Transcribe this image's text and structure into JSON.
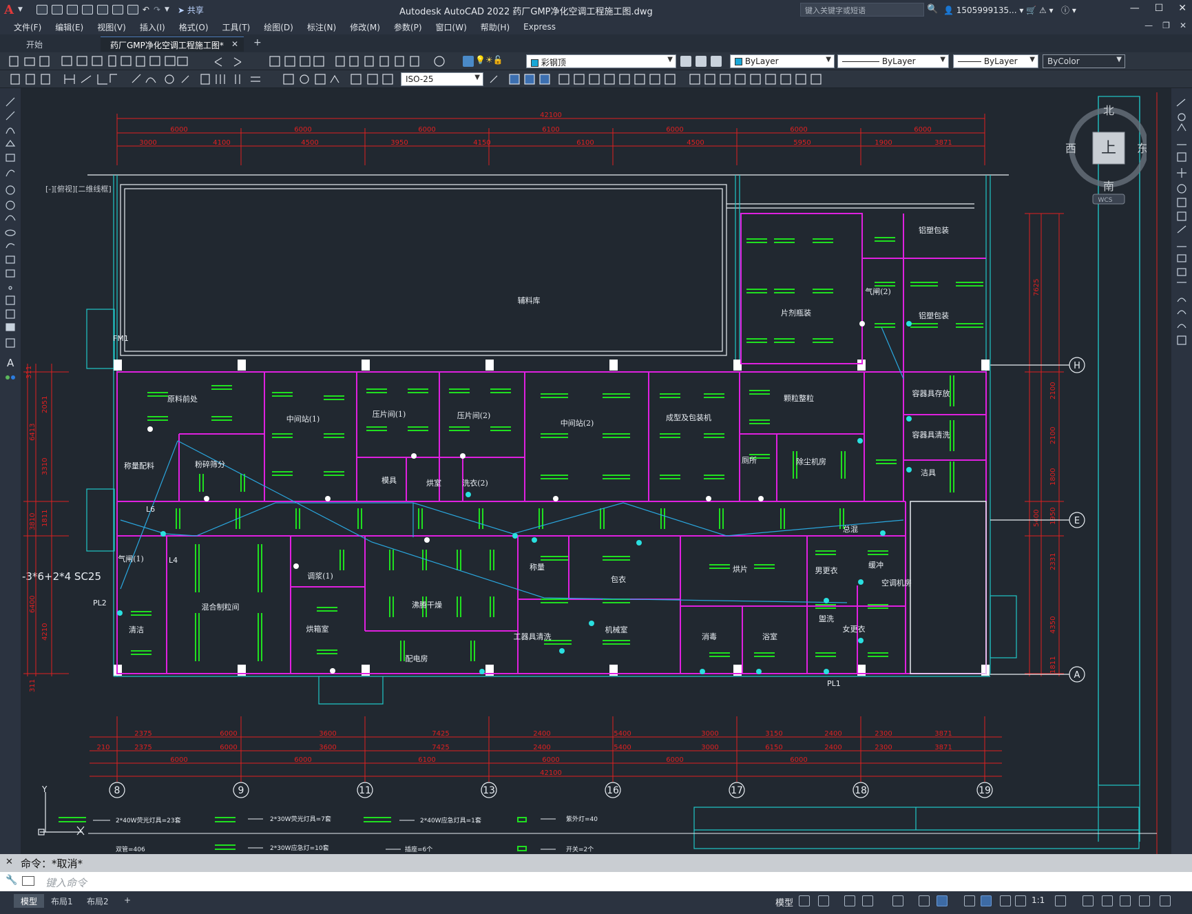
{
  "titlebar": {
    "logo": "A",
    "share": "共享",
    "app_title": "Autodesk AutoCAD 2022    药厂GMP净化空调工程施工图.dwg",
    "search_placeholder": "键入关键字或短语",
    "user": "1505999135...",
    "minimize": "—",
    "restore": "☐",
    "close": "✕"
  },
  "menu": [
    "文件(F)",
    "编辑(E)",
    "视图(V)",
    "插入(I)",
    "格式(O)",
    "工具(T)",
    "绘图(D)",
    "标注(N)",
    "修改(M)",
    "参数(P)",
    "窗口(W)",
    "帮助(H)",
    "Express"
  ],
  "tabs": {
    "start": "开始",
    "active": "药厂GMP净化空调工程施工图*",
    "add": "+"
  },
  "toolbar": {
    "layer": "彩钢顶",
    "color": "ByLayer",
    "linetype": "ByLayer",
    "lineweight": "ByLayer",
    "plotstyle": "ByColor",
    "dimstyle": "ISO-25"
  },
  "viewport_label": "[-][俯视][二维线框]",
  "navcube": {
    "north": "北",
    "south": "南",
    "east": "东",
    "west": "西",
    "top": "上",
    "ucs": "WCS"
  },
  "drawing": {
    "top_total": "42100",
    "top_row1": [
      "6000",
      "6000",
      "6000",
      "6100",
      "6000",
      "6000",
      "6000"
    ],
    "top_row2": [
      "3000",
      "4100",
      "4500",
      "3950",
      "4150",
      "6100",
      "4500",
      "5950",
      "1900",
      "3871"
    ],
    "bottom_row1": [
      "2375",
      "6000",
      "3600",
      "7425",
      "2400",
      "5400",
      "3000",
      "3150",
      "2400",
      "2300",
      "3871"
    ],
    "bottom_row2": [
      "210",
      "2375",
      "6000",
      "3600",
      "7425",
      "2400",
      "5400",
      "3000",
      "6150",
      "2400",
      "2300",
      "3871"
    ],
    "bottom_row3": [
      "6000",
      "6000",
      "6100",
      "6000",
      "6000",
      "6000"
    ],
    "bottom_total": "42100",
    "grid_bottom": [
      "8",
      "9",
      "11",
      "13",
      "16",
      "17",
      "18",
      "19"
    ],
    "grid_right": [
      "H",
      "E",
      "A"
    ],
    "right_dims": [
      "7625",
      "2100",
      "2100",
      "1800",
      "1950",
      "5400",
      "2331",
      "4350",
      "1811"
    ],
    "left_dims": [
      "311",
      "2051",
      "6413",
      "3310",
      "1811",
      "3810",
      "6400",
      "4210",
      "311"
    ],
    "cable_label": "-3*6+2*4  SC25",
    "labels": {
      "fm1": "FM1",
      "pl1": "PL1",
      "pl2": "PL2",
      "l4": "L4",
      "l6": "L6"
    },
    "rooms": [
      "辅料库",
      "片剂瓶装",
      "铝塑包装",
      "铝塑包装",
      "气闸(2)",
      "原料前处",
      "中间站(1)",
      "压片间(1)",
      "压片间(2)",
      "中间站(2)",
      "成型及包装机",
      "颗粒整粒",
      "容器具存放",
      "容器具清洗",
      "洁具",
      "称量配料",
      "粉碎筛分",
      "模具",
      "烘室",
      "洗衣(2)",
      "总混",
      "空调机房",
      "气闸(1)",
      "混合制粒间",
      "调浆(1)",
      "沸腾干燥",
      "称量",
      "包衣",
      "烘片",
      "男更衣",
      "女更衣",
      "缓冲",
      "盥洗",
      "工器具清洗",
      "机械室",
      "消毒",
      "浴室",
      "厕所",
      "清洁",
      "配电房",
      "除尘机房",
      "烘箱室"
    ],
    "legend": [
      "2*40W荧光灯具=23套",
      "2*30W荧光灯具=7套",
      "2*40W应急灯具=1套",
      "紫外灯=40",
      "2*30W应急灯=10套",
      "插座=6个",
      "开关=2个",
      "双管=406"
    ]
  },
  "command": {
    "history": "命令：*取消*",
    "placeholder": "键入命令"
  },
  "status": {
    "layout_tabs": [
      "模型",
      "布局1",
      "布局2"
    ],
    "add_layout": "+",
    "model": "模型",
    "scale": "1:1"
  },
  "colors": {
    "background": "#212830",
    "wall": "#e020e0",
    "dimension": "#e02020",
    "fixture": "#20e020",
    "outline": "#20c8c8",
    "wiring": "#2aa8e0"
  }
}
